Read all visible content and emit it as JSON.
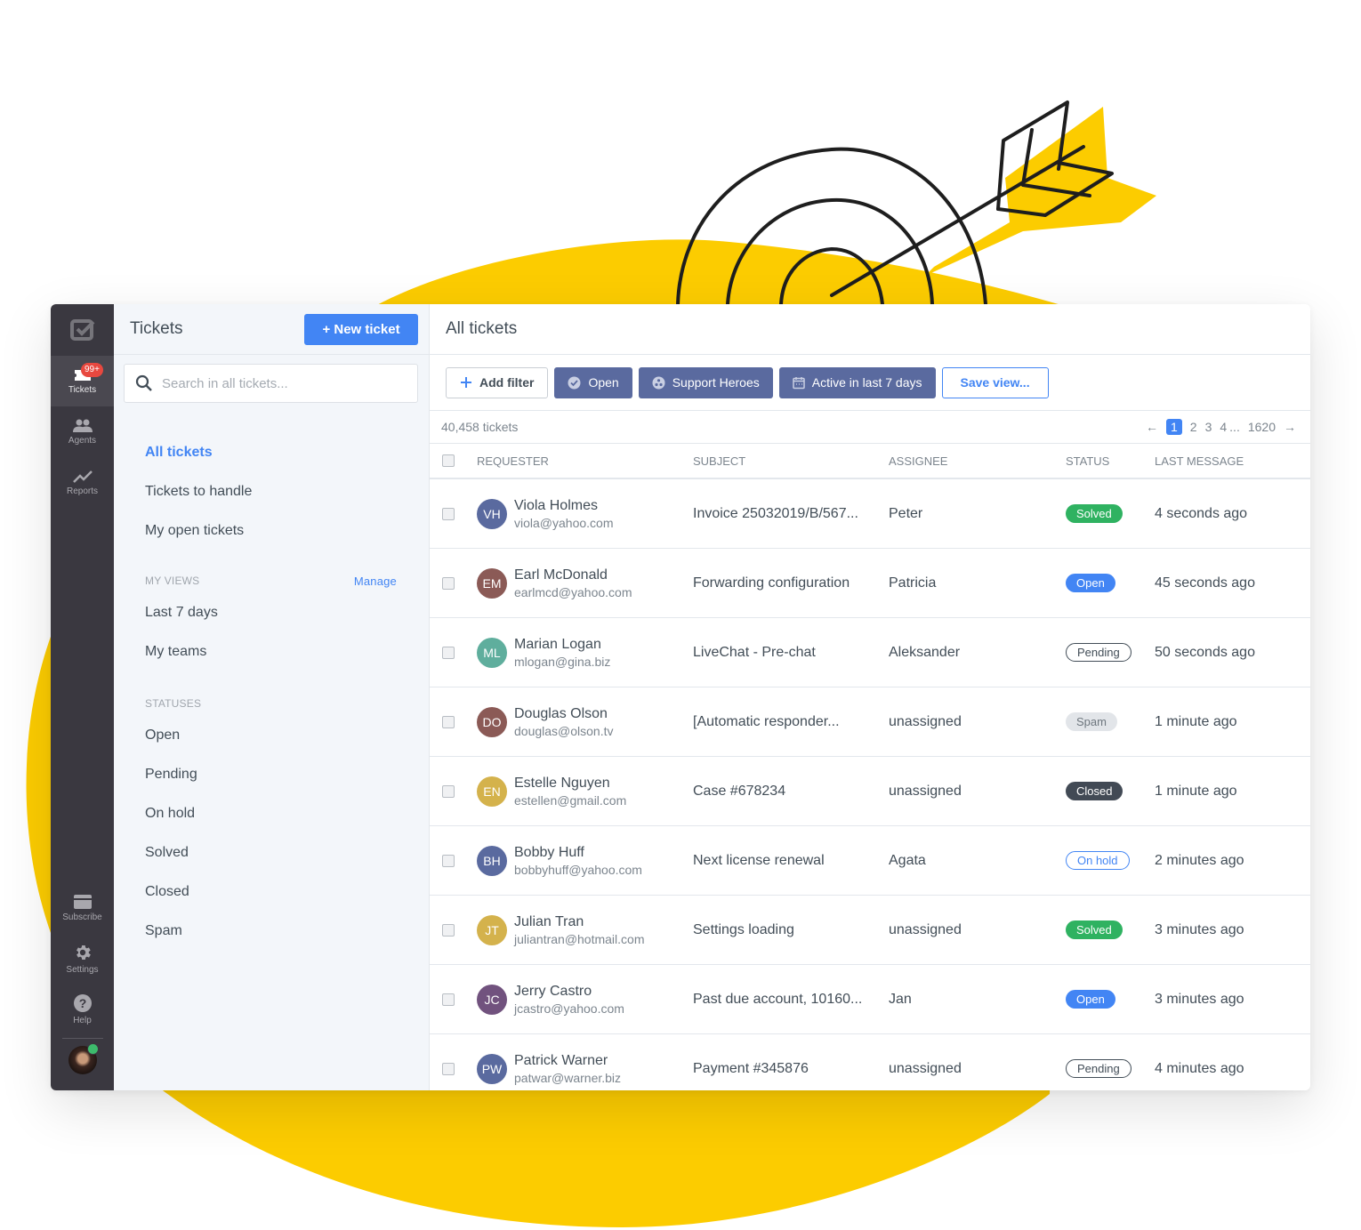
{
  "colors": {
    "accent": "#4285f4",
    "rail_bg": "#3a3840",
    "sidebar_bg": "#f3f6fa",
    "filter_pill": "#5a6a9f",
    "yellow_blob": "#fccc00",
    "status_solved": "#2fb261",
    "status_open": "#4285f4",
    "status_closed": "#424a55",
    "status_spam": "#e2e5e9",
    "badge": "#e8483f"
  },
  "rail": {
    "items": [
      {
        "label": "Tickets",
        "icon": "ticket-icon",
        "badge": "99+"
      },
      {
        "label": "Agents",
        "icon": "agents-icon"
      },
      {
        "label": "Reports",
        "icon": "reports-icon"
      }
    ],
    "bottom": [
      {
        "label": "Subscribe",
        "icon": "credit-card-icon"
      },
      {
        "label": "Settings",
        "icon": "gear-icon"
      },
      {
        "label": "Help",
        "icon": "help-icon"
      }
    ]
  },
  "sidebar": {
    "title": "Tickets",
    "new_ticket": "+ New ticket",
    "search_placeholder": "Search in all tickets...",
    "main_items": [
      "All tickets",
      "Tickets to handle",
      "My open tickets"
    ],
    "my_views_label": "MY VIEWS",
    "manage_label": "Manage",
    "views": [
      "Last 7 days",
      "My teams"
    ],
    "statuses_label": "STATUSES",
    "statuses": [
      "Open",
      "Pending",
      "On hold",
      "Solved",
      "Closed",
      "Spam"
    ]
  },
  "main": {
    "title": "All tickets",
    "filters": {
      "add_filter": "Add filter",
      "open": "Open",
      "team": "Support Heroes",
      "period": "Active in last 7 days",
      "save_view": "Save view..."
    },
    "count": "40,458 tickets",
    "pager": {
      "prev": "←",
      "pages": [
        "1",
        "2",
        "3",
        "4"
      ],
      "ellipsis": "...",
      "last": "1620",
      "next": "→",
      "current": "1"
    },
    "columns": [
      "REQUESTER",
      "SUBJECT",
      "ASSIGNEE",
      "STATUS",
      "LAST MESSAGE"
    ],
    "rows": [
      {
        "initials": "VH",
        "color": "#5a6a9f",
        "name": "Viola Holmes",
        "email": "viola@yahoo.com",
        "subject": "Invoice 25032019/B/567...",
        "assignee": "Peter",
        "status": "Solved",
        "status_class": "st-solved",
        "last": "4 seconds ago"
      },
      {
        "initials": "EM",
        "color": "#8b5a56",
        "name": "Earl McDonald",
        "email": "earlmcd@yahoo.com",
        "subject": "Forwarding configuration",
        "assignee": "Patricia",
        "status": "Open",
        "status_class": "st-open",
        "last": "45 seconds ago"
      },
      {
        "initials": "ML",
        "color": "#5fae9d",
        "name": "Marian Logan",
        "email": "mlogan@gina.biz",
        "subject": "LiveChat - Pre-chat",
        "assignee": "Aleksander",
        "status": "Pending",
        "status_class": "st-pending",
        "last": "50 seconds ago"
      },
      {
        "initials": "DO",
        "color": "#8b5a56",
        "name": "Douglas Olson",
        "email": "douglas@olson.tv",
        "subject": "[Automatic responder...",
        "assignee": "unassigned",
        "status": "Spam",
        "status_class": "st-spam",
        "last": "1 minute ago"
      },
      {
        "initials": "EN",
        "color": "#d4b24c",
        "name": "Estelle Nguyen",
        "email": "estellen@gmail.com",
        "subject": "Case #678234",
        "assignee": "unassigned",
        "status": "Closed",
        "status_class": "st-closed",
        "last": "1 minute ago"
      },
      {
        "initials": "BH",
        "color": "#5a6a9f",
        "name": "Bobby Huff",
        "email": "bobbyhuff@yahoo.com",
        "subject": "Next license renewal",
        "assignee": "Agata",
        "status": "On hold",
        "status_class": "st-onhold",
        "last": "2 minutes ago"
      },
      {
        "initials": "JT",
        "color": "#d4b24c",
        "name": "Julian Tran",
        "email": "juliantran@hotmail.com",
        "subject": "Settings loading",
        "assignee": "unassigned",
        "status": "Solved",
        "status_class": "st-solved",
        "last": "3 minutes ago"
      },
      {
        "initials": "JC",
        "color": "#71527e",
        "name": "Jerry Castro",
        "email": "jcastro@yahoo.com",
        "subject": "Past due account, 10160...",
        "assignee": "Jan",
        "status": "Open",
        "status_class": "st-open",
        "last": "3 minutes ago"
      },
      {
        "initials": "PW",
        "color": "#5a6a9f",
        "name": "Patrick Warner",
        "email": "patwar@warner.biz",
        "subject": "Payment #345876",
        "assignee": "unassigned",
        "status": "Pending",
        "status_class": "st-pending",
        "last": "4 minutes ago"
      }
    ]
  }
}
